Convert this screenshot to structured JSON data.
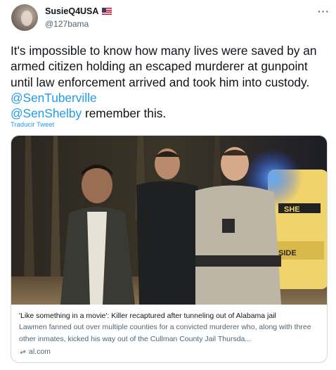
{
  "author": {
    "display_name": "SusieQ4USA",
    "flag_icon": "us-flag-icon",
    "handle": "@127bama"
  },
  "more_menu": {
    "label": "···"
  },
  "tweet": {
    "text_before": "It's impossible to know how many lives were saved by an armed citizen holding an escaped murderer at gunpoint until law enforcement arrived and took him into custody.  ",
    "mention_1": "@SenTuberville",
    "mention_2": "@SenShelby",
    "text_after": " remember this.",
    "translate_label": "Traducir Tweet"
  },
  "link_card": {
    "title": "'Like something in a movie': Killer recaptured after tunneling out of Alabama jail",
    "description": "Lawmen fanned out over multiple counties for a convicted murderer who, along with three other inmates, kicked his way out of the Cullman County Jail Thursda...",
    "domain": "al.com",
    "domain_icon": "link-icon",
    "photo_badge_text": "SHE",
    "photo_plate_text": "SIDE"
  },
  "colors": {
    "accent": "#1d9bf0",
    "text_primary": "#0f1419",
    "text_secondary": "#536471",
    "border": "#cfd9de"
  }
}
